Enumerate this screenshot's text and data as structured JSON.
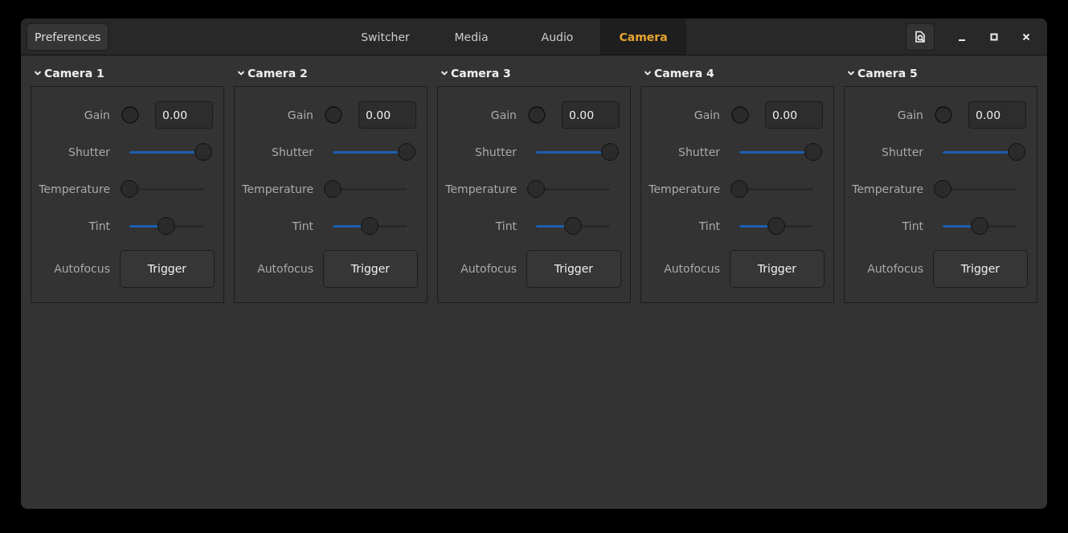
{
  "header": {
    "preferences_button": "Preferences",
    "tabs": [
      {
        "label": "Switcher",
        "selected": false
      },
      {
        "label": "Media",
        "selected": false
      },
      {
        "label": "Audio",
        "selected": false
      },
      {
        "label": "Camera",
        "selected": true
      }
    ]
  },
  "cameras": [
    {
      "title": "Camera 1",
      "expanded": true,
      "gain_label": "Gain",
      "gain_value": "0.00",
      "sliders": [
        {
          "label": "Shutter",
          "level": 1.0
        },
        {
          "label": "Temperature",
          "level": 0.0
        },
        {
          "label": "Tint",
          "level": 0.5
        }
      ],
      "autofocus_label": "Autofocus",
      "autofocus_button": "Trigger"
    },
    {
      "title": "Camera 2",
      "expanded": true,
      "gain_label": "Gain",
      "gain_value": "0.00",
      "sliders": [
        {
          "label": "Shutter",
          "level": 1.0
        },
        {
          "label": "Temperature",
          "level": 0.0
        },
        {
          "label": "Tint",
          "level": 0.5
        }
      ],
      "autofocus_label": "Autofocus",
      "autofocus_button": "Trigger"
    },
    {
      "title": "Camera 3",
      "expanded": true,
      "gain_label": "Gain",
      "gain_value": "0.00",
      "sliders": [
        {
          "label": "Shutter",
          "level": 1.0
        },
        {
          "label": "Temperature",
          "level": 0.0
        },
        {
          "label": "Tint",
          "level": 0.5
        }
      ],
      "autofocus_label": "Autofocus",
      "autofocus_button": "Trigger"
    },
    {
      "title": "Camera 4",
      "expanded": true,
      "gain_label": "Gain",
      "gain_value": "0.00",
      "sliders": [
        {
          "label": "Shutter",
          "level": 1.0
        },
        {
          "label": "Temperature",
          "level": 0.0
        },
        {
          "label": "Tint",
          "level": 0.5
        }
      ],
      "autofocus_label": "Autofocus",
      "autofocus_button": "Trigger"
    },
    {
      "title": "Camera 5",
      "expanded": true,
      "gain_label": "Gain",
      "gain_value": "0.00",
      "sliders": [
        {
          "label": "Shutter",
          "level": 1.0
        },
        {
          "label": "Temperature",
          "level": 0.0
        },
        {
          "label": "Tint",
          "level": 0.5
        }
      ],
      "autofocus_label": "Autofocus",
      "autofocus_button": "Trigger"
    }
  ]
}
